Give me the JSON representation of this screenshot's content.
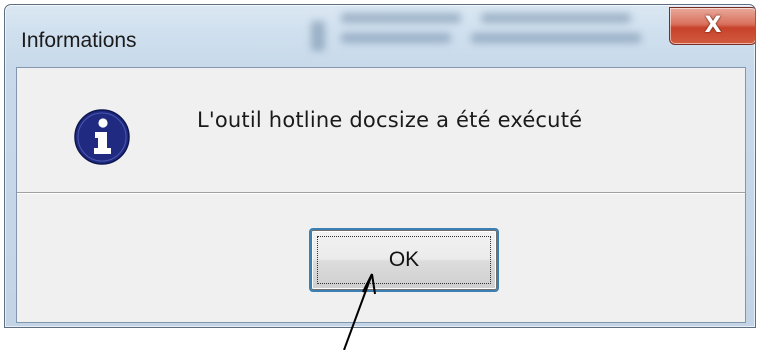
{
  "dialog": {
    "title": "Informations",
    "close_glyph": "X",
    "message": "L'outil hotline docsize a été exécuté",
    "ok_label": "OK",
    "icon": "information-icon"
  },
  "colors": {
    "icon_fill": "#1f2a80",
    "close_red": "#c7422a",
    "focus_blue": "#3c7fb1",
    "client_bg": "#f0f0f0"
  },
  "annotation": {
    "arrow_icon": "annotation-arrow-icon"
  }
}
